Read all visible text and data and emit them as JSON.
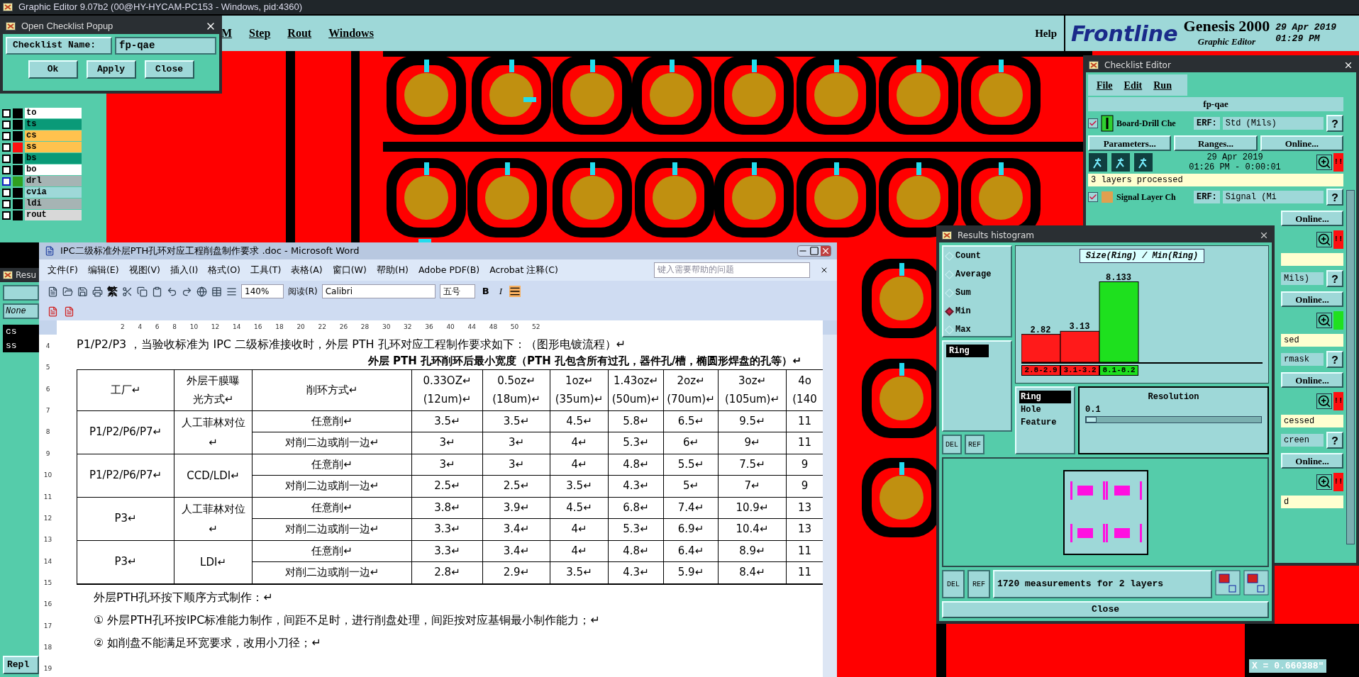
{
  "window": {
    "title": "Graphic Editor 9.07b2 (00@HY-HYCAM-PC153 - Windows, pid:4360)"
  },
  "menu": [
    {
      "label": "M"
    },
    {
      "label": "Step"
    },
    {
      "label": "Rout"
    },
    {
      "label": "Windows"
    }
  ],
  "help_menu": "Help",
  "brand": {
    "logo": "Frontline",
    "product": "Genesis 2000",
    "subtitle": "Graphic Editor",
    "date": "29 Apr 2019",
    "time": "01:29 PM"
  },
  "open_checklist_popup": {
    "title": "Open Checklist Popup",
    "name_label": "Checklist Name:",
    "name_value": "fp-qae",
    "buttons": [
      "Ok",
      "Apply",
      "Close"
    ]
  },
  "layers": [
    {
      "name": "to",
      "color": "#ffffff",
      "checked": false,
      "displayed": false,
      "work": false
    },
    {
      "name": "ts",
      "color": "#0a9a78",
      "checked": false,
      "displayed": false,
      "work": false
    },
    {
      "name": "cs",
      "color": "#ffc24e",
      "checked": false,
      "displayed": false,
      "work": false
    },
    {
      "name": "ss",
      "color": "#ffc24e",
      "checked": false,
      "displayed": true,
      "work": false
    },
    {
      "name": "bs",
      "color": "#0a9a78",
      "checked": false,
      "displayed": false,
      "work": false
    },
    {
      "name": "bo",
      "color": "#ffffff",
      "checked": false,
      "displayed": false,
      "work": false
    },
    {
      "name": "drl",
      "color": "#a6b4b4",
      "checked": false,
      "displayed": false,
      "work": true
    },
    {
      "name": "cvia",
      "color": "#9ed8d8",
      "checked": false,
      "displayed": false,
      "work": false
    },
    {
      "name": "ldi",
      "color": "#a6b4b4",
      "checked": false,
      "displayed": false,
      "work": false
    },
    {
      "name": "rout",
      "color": "#d8d8d8",
      "checked": false,
      "displayed": false,
      "work": false
    }
  ],
  "results_panel": {
    "title": "Resu",
    "field": "None",
    "items": [
      {
        "label": "cs",
        "selected": true
      },
      {
        "label": "ss",
        "selected": true
      }
    ],
    "button": "Repl"
  },
  "word": {
    "title": "IPC二级标准外层PTH孔环对应工程削盘制作要求 .doc - Microsoft Word",
    "menu": [
      "文件(F)",
      "编辑(E)",
      "视图(V)",
      "插入(I)",
      "格式(O)",
      "工具(T)",
      "表格(A)",
      "窗口(W)",
      "帮助(H)",
      "Adobe PDF(B)",
      "Acrobat 注释(C)"
    ],
    "help_placeholder": "键入需要帮助的问题",
    "toolbar": {
      "traditional": "繁",
      "zoom": "140%",
      "reading": "阅读(R)",
      "font": "Calibri",
      "size": "五号",
      "bold": "B",
      "italic": "I"
    },
    "ruler": [
      "2",
      "4",
      "6",
      "8",
      "10",
      "12",
      "14",
      "16",
      "18",
      "20",
      "22",
      "26",
      "28",
      "30",
      "32",
      "36",
      "40",
      "44",
      "48",
      "50",
      "52"
    ],
    "vruler": [
      "4",
      "5",
      "6",
      "7",
      "8",
      "9",
      "10",
      "11",
      "12",
      "13",
      "14",
      "15",
      "16",
      "17",
      "18",
      "19"
    ],
    "intro": "P1/P2/P3 ，当验收标准为 IPC 二级标准接收时，外层 PTH 孔环对应工程制作要求如下：（图形电镀流程）↵",
    "caption": "外层 PTH 孔环削环后最小宽度（PTH 孔包含所有过孔，器件孔/槽，椭圆形焊盘的孔等）↵",
    "table": {
      "columns": [
        [
          "工厂↵"
        ],
        [
          "外层干膜曝",
          "光方式↵"
        ],
        [
          "削环方式↵"
        ],
        [
          "0.33OZ↵",
          "(12um)↵"
        ],
        [
          "0.5oz↵",
          "(18um)↵"
        ],
        [
          "1oz↵",
          "(35um)↵"
        ],
        [
          "1.43oz↵",
          "(50um)↵"
        ],
        [
          "2oz↵",
          "(70um)↵"
        ],
        [
          "3oz↵",
          "(105um)↵"
        ],
        [
          "4o",
          "(140"
        ]
      ],
      "groups": [
        {
          "factory": "P1/P2/P6/P7↵",
          "exposure": "人工菲林对位↵",
          "rows": [
            {
              "method": "任意削↵",
              "values": [
                "3.5↵",
                "3.5↵",
                "4.5↵",
                "5.8↵",
                "6.5↵",
                "9.5↵",
                "11"
              ]
            },
            {
              "method": "对削二边或削一边↵",
              "values": [
                "3↵",
                "3↵",
                "4↵",
                "5.3↵",
                "6↵",
                "9↵",
                "11"
              ]
            }
          ]
        },
        {
          "factory": "P1/P2/P6/P7↵",
          "exposure": "CCD/LDI↵",
          "rows": [
            {
              "method": "任意削↵",
              "values": [
                "3↵",
                "3↵",
                "4↵",
                "4.8↵",
                "5.5↵",
                "7.5↵",
                "9"
              ]
            },
            {
              "method": "对削二边或削一边↵",
              "values": [
                "2.5↵",
                "2.5↵",
                "3.5↵",
                "4.3↵",
                "5↵",
                "7↵",
                "9"
              ]
            }
          ]
        },
        {
          "factory": "P3↵",
          "exposure": "人工菲林对位↵",
          "rows": [
            {
              "method": "任意削↵",
              "values": [
                "3.8↵",
                "3.9↵",
                "4.5↵",
                "6.8↵",
                "7.4↵",
                "10.9↵",
                "13"
              ]
            },
            {
              "method": "对削二边或削一边↵",
              "values": [
                "3.3↵",
                "3.4↵",
                "4↵",
                "5.3↵",
                "6.9↵",
                "10.4↵",
                "13"
              ]
            }
          ]
        },
        {
          "factory": "P3↵",
          "exposure": "LDI↵",
          "rows": [
            {
              "method": "任意削↵",
              "values": [
                "3.3↵",
                "3.4↵",
                "4↵",
                "4.8↵",
                "6.4↵",
                "8.9↵",
                "11"
              ]
            },
            {
              "method": "对削二边或削一边↵",
              "values": [
                "2.8↵",
                "2.9↵",
                "3.5↵",
                "4.3↵",
                "5.9↵",
                "8.4↵",
                "11"
              ]
            }
          ]
        }
      ]
    },
    "after": [
      "外层PTH孔环按下顺序方式制作：↵",
      "①  外层PTH孔环按IPC标准能力制作，间距不足时，进行削盘处理，间距按对应基铜最小制作能力；↵",
      "②  如削盘不能满足环宽要求，改用小刀径；↵"
    ]
  },
  "histogram": {
    "title": "Results histogram",
    "modes": [
      {
        "label": "Count",
        "selected": false
      },
      {
        "label": "Average",
        "selected": false
      },
      {
        "label": "Sum",
        "selected": false
      },
      {
        "label": "Min",
        "selected": true
      },
      {
        "label": "Max",
        "selected": false
      }
    ],
    "list": [
      {
        "label": "Ring",
        "selected": true
      }
    ],
    "chart_data": {
      "type": "bar",
      "title": "Size(Ring) / Min(Ring)",
      "categories": [
        "2.8-2.9",
        "3.1-3.2",
        "8.1-8.2"
      ],
      "values": [
        2.82,
        3.13,
        8.133
      ],
      "value_labels": [
        "2.82",
        "3.13",
        "8.133"
      ]
    },
    "bins": [
      {
        "color": "#ff1a1a"
      },
      {
        "color": "#ff1a1a"
      },
      {
        "color": "#1ee01e"
      }
    ],
    "measures": [
      {
        "label": "Ring",
        "selected": true
      },
      {
        "label": "Hole",
        "selected": false
      },
      {
        "label": "Feature",
        "selected": false
      }
    ],
    "resolution": {
      "label": "Resolution",
      "value": "0.1",
      "level": 0.06
    },
    "list_del": "DEL",
    "list_ref": "REF",
    "del": "DEL",
    "ref": "REF",
    "status": "1720 measurements for 2 layers",
    "close": "Close"
  },
  "checklist_editor": {
    "title": "Checklist Editor",
    "menu": [
      "File",
      "Edit",
      "Run"
    ],
    "name": "fp-qae",
    "action": {
      "checked": true,
      "name": "Board-Drill Che",
      "erf": "ERF:",
      "erf_value": "Std (Mils)",
      "help": "?",
      "buttons": [
        "Parameters...",
        "Ranges...",
        "Online..."
      ],
      "date": "29 Apr 2019",
      "time": "01:26 PM - 0:00:01",
      "passed": false,
      "flag": "!!",
      "status": "3 layers processed"
    },
    "action2": {
      "checked": true,
      "name": "Signal Layer Ch",
      "erf": "ERF:",
      "erf_value": "Signal (Mi",
      "help": "?"
    },
    "fragments": [
      {
        "kind": "button",
        "text": "Online..."
      },
      {
        "kind": "result",
        "passed": false,
        "flag": "!!"
      },
      {
        "kind": "status"
      },
      {
        "kind": "erf",
        "text": "Mils)",
        "help": "?"
      },
      {
        "kind": "button",
        "text": "Online..."
      },
      {
        "kind": "result",
        "passed": true
      },
      {
        "kind": "status",
        "text": "sed"
      },
      {
        "kind": "erf",
        "text": "rmask",
        "help": "?"
      },
      {
        "kind": "button",
        "text": "Online..."
      },
      {
        "kind": "result",
        "passed": false,
        "flag": "!!"
      },
      {
        "kind": "status",
        "text": "cessed"
      },
      {
        "kind": "erf",
        "text": "creen",
        "help": "?"
      },
      {
        "kind": "button",
        "text": "Online..."
      },
      {
        "kind": "result",
        "passed": false,
        "flag": "!!"
      },
      {
        "kind": "status",
        "text": "d"
      }
    ]
  },
  "coordinates": "X = 0.660388\""
}
